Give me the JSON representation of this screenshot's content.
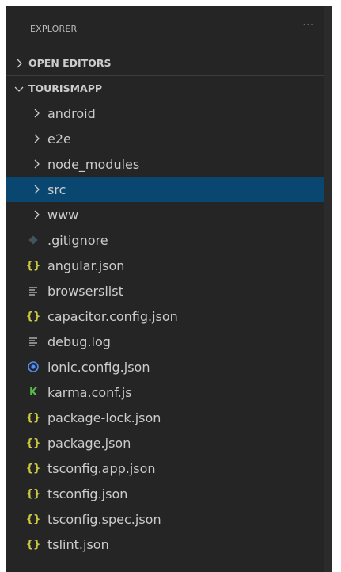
{
  "explorer": {
    "title": "EXPLORER",
    "more_label": "···"
  },
  "sections": {
    "open_editors": "OPEN EDITORS",
    "project": "TOURISMAPP"
  },
  "folders": [
    {
      "label": "android"
    },
    {
      "label": "e2e"
    },
    {
      "label": "node_modules"
    },
    {
      "label": "src",
      "selected": true
    },
    {
      "label": "www"
    }
  ],
  "files": [
    {
      "label": ".gitignore",
      "icon": "git-icon"
    },
    {
      "label": "angular.json",
      "icon": "json-braces-icon"
    },
    {
      "label": "browserslist",
      "icon": "text-lines-icon"
    },
    {
      "label": "capacitor.config.json",
      "icon": "json-braces-icon"
    },
    {
      "label": "debug.log",
      "icon": "text-lines-icon"
    },
    {
      "label": "ionic.config.json",
      "icon": "ionic-icon"
    },
    {
      "label": "karma.conf.js",
      "icon": "karma-icon"
    },
    {
      "label": "package-lock.json",
      "icon": "json-braces-icon"
    },
    {
      "label": "package.json",
      "icon": "json-braces-icon"
    },
    {
      "label": "tsconfig.app.json",
      "icon": "json-braces-icon"
    },
    {
      "label": "tsconfig.json",
      "icon": "json-braces-icon"
    },
    {
      "label": "tsconfig.spec.json",
      "icon": "json-braces-icon"
    },
    {
      "label": "tslint.json",
      "icon": "json-braces-icon"
    }
  ],
  "colors": {
    "background": "#252526",
    "selection": "#094771",
    "json_icon": "#cbcb41",
    "ionic_icon": "#4f8ff7",
    "karma_icon": "#56b948"
  }
}
